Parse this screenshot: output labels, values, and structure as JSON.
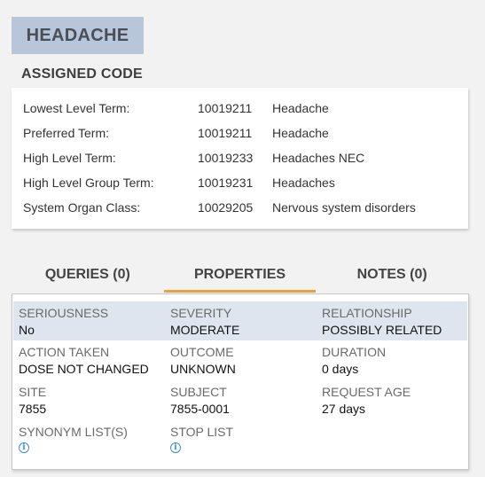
{
  "term": "HEADACHE",
  "assigned_code": {
    "title": "ASSIGNED CODE",
    "rows": [
      {
        "label": "Lowest Level Term:",
        "code": "10019211",
        "name": "Headache"
      },
      {
        "label": "Preferred Term:",
        "code": "10019211",
        "name": "Headache"
      },
      {
        "label": "High Level Term:",
        "code": "10019233",
        "name": "Headaches NEC"
      },
      {
        "label": "High Level Group Term:",
        "code": "10019231",
        "name": "Headaches"
      },
      {
        "label": "System Organ Class:",
        "code": "10029205",
        "name": "Nervous system disorders"
      }
    ]
  },
  "tabs": [
    {
      "label": "QUERIES (0)"
    },
    {
      "label": "PROPERTIES",
      "active": true
    },
    {
      "label": "NOTES (0)"
    }
  ],
  "properties": {
    "seriousness": {
      "label": "SERIOUSNESS",
      "value": "No"
    },
    "severity": {
      "label": "SEVERITY",
      "value": "MODERATE"
    },
    "relationship": {
      "label": "RELATIONSHIP",
      "value": "POSSIBLY RELATED"
    },
    "action_taken": {
      "label": "ACTION TAKEN",
      "value": "DOSE NOT CHANGED"
    },
    "outcome": {
      "label": "OUTCOME",
      "value": "UNKNOWN"
    },
    "duration": {
      "label": "DURATION",
      "value": "0 days"
    },
    "site": {
      "label": "SITE",
      "value": "7855"
    },
    "subject": {
      "label": "SUBJECT",
      "value": "7855-0001"
    },
    "request_age": {
      "label": "REQUEST AGE",
      "value": "27 days"
    },
    "synonym_list": {
      "label": "SYNONYM LIST(S)",
      "icon": "info-icon"
    },
    "stop_list": {
      "label": "STOP LIST",
      "icon": "info-icon"
    }
  },
  "colors": {
    "badge_bg": "#b8c6da",
    "active_tab_underline": "#e8a33d",
    "highlight_row": "#dfe5ee",
    "info_icon": "#3a8bd6"
  }
}
